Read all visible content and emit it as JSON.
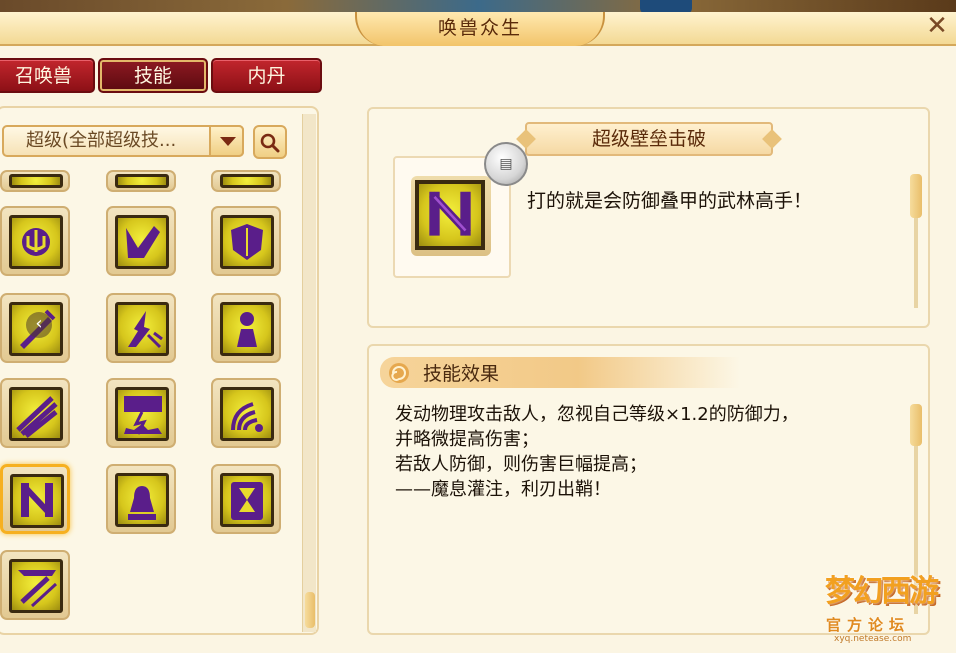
{
  "window": {
    "title": "唤兽众生",
    "close_label": "✕"
  },
  "tabs": [
    {
      "label": "召唤兽",
      "active": false
    },
    {
      "label": "技能",
      "active": true
    },
    {
      "label": "内丹",
      "active": false
    }
  ],
  "filter": {
    "selected": "超级(全部超级技...",
    "search_icon": "search-icon"
  },
  "skill_list": {
    "rows": 6,
    "columns": 3,
    "selected_index": 12,
    "icons": [
      "partial-icon",
      "partial-icon",
      "partial-icon",
      "sun-trident-icon",
      "broken-arm-icon",
      "shield-icon",
      "sword-icon",
      "lightning-burst-icon",
      "figure-icon",
      "claw-strike-icon",
      "lightning-ground-icon",
      "wave-icon",
      "shield-break-icon",
      "bell-icon",
      "hourglass-icon",
      "spear-icon"
    ]
  },
  "detail": {
    "skill_name": "超级壁垒击破",
    "short_desc": "打的就是会防御叠甲的武林高手！",
    "badge_icon": "scroll-icon"
  },
  "effect": {
    "title": "技能效果",
    "lines": [
      "发动物理攻击敌人，忽视自己等级×1.2的防御力，",
      "并略微提高伤害；",
      "若敌人防御，则伤害巨幅提高；",
      "——魔息灌注，利刃出鞘！"
    ]
  },
  "watermark": {
    "logo": "梦幻西游",
    "sub": "官方论坛",
    "url": "xyq.netease.com"
  },
  "colors": {
    "accent_red": "#a8161c",
    "gold": "#f2c46a",
    "icon_yellow": "#e8dc2c",
    "icon_purple": "#5a1e8a"
  }
}
